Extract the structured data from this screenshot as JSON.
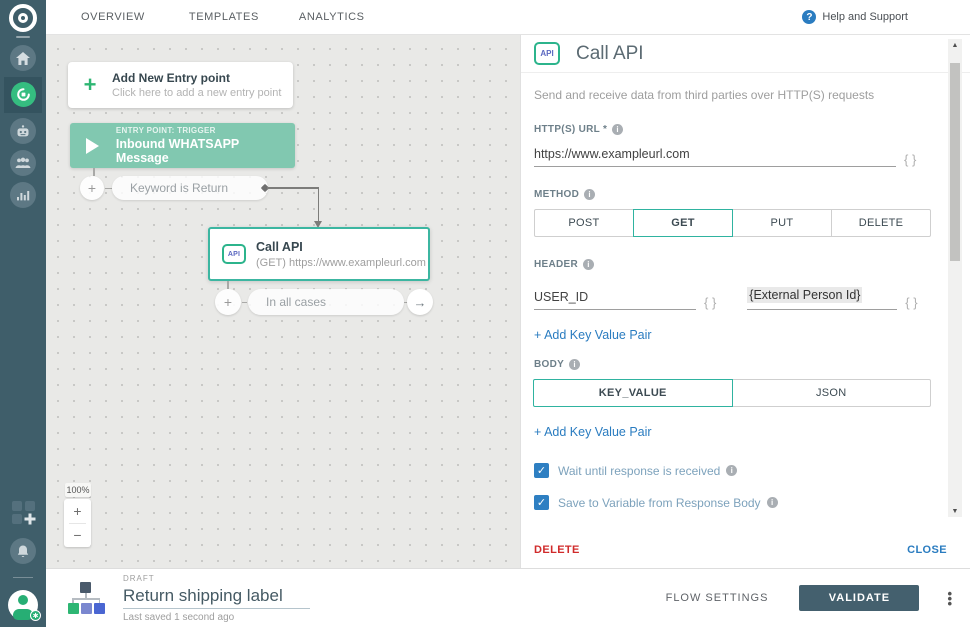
{
  "nav": {
    "items": [
      "OVERVIEW",
      "TEMPLATES",
      "ANALYTICS"
    ],
    "help_label": "Help and Support"
  },
  "canvas": {
    "entry_card": {
      "plus": "+",
      "title": "Add New Entry point",
      "subtitle": "Click here to add a new entry point"
    },
    "trigger_node": {
      "kicker": "ENTRY POINT: TRIGGER",
      "title": "Inbound WHATSAPP Message"
    },
    "keyword_pill": {
      "label": "Keyword is Return"
    },
    "api_node": {
      "icon_label": "API",
      "title": "Call API",
      "subtitle": "(GET) https://www.exampleurl.com"
    },
    "cases_pill": {
      "label": "In all cases",
      "arrow": "→",
      "plus": "+"
    },
    "zoom": {
      "level": "100%",
      "zoom_in": "+",
      "zoom_out": "−"
    }
  },
  "panel": {
    "icon_label": "API",
    "title": "Call API",
    "description": "Send and receive data from third parties over HTTP(S) requests",
    "url_field": {
      "label": "HTTP(S) URL *",
      "value": "https://www.exampleurl.com",
      "braces": "{ }"
    },
    "method": {
      "label": "METHOD",
      "options": [
        "POST",
        "GET",
        "PUT",
        "DELETE"
      ],
      "selected": "GET"
    },
    "header_section": {
      "label": "HEADER",
      "key_value": "USER_ID",
      "value_token": "{External Person Id}",
      "braces": "{ }",
      "add_link": "+ Add Key Value Pair"
    },
    "body_section": {
      "label": "BODY",
      "options": [
        "KEY_VALUE",
        "JSON"
      ],
      "selected": "KEY_VALUE",
      "add_link": "+ Add Key Value Pair"
    },
    "checkbox_wait": {
      "label": "Wait until response is received",
      "checked": "✓"
    },
    "checkbox_save": {
      "label": "Save to Variable from Response Body",
      "checked": "✓"
    },
    "footer": {
      "delete_label": "DELETE",
      "close_label": "CLOSE"
    }
  },
  "bottom_bar": {
    "status": "DRAFT",
    "flow_name": "Return shipping label",
    "last_saved": "Last saved 1 second ago",
    "flow_settings_label": "FLOW SETTINGS",
    "validate_label": "VALIDATE"
  },
  "colors": {
    "sidebar": "#3f5e6a",
    "active_green": "#35bd80",
    "trigger_green": "#81c8b0",
    "accent_teal": "#2fb3a0",
    "link_blue": "#2a7cc0",
    "checkbox_blue": "#2e7fc2",
    "delete_red": "#d02b2b",
    "close_blue": "#2a7cc0",
    "validate_slate": "#44606e"
  }
}
